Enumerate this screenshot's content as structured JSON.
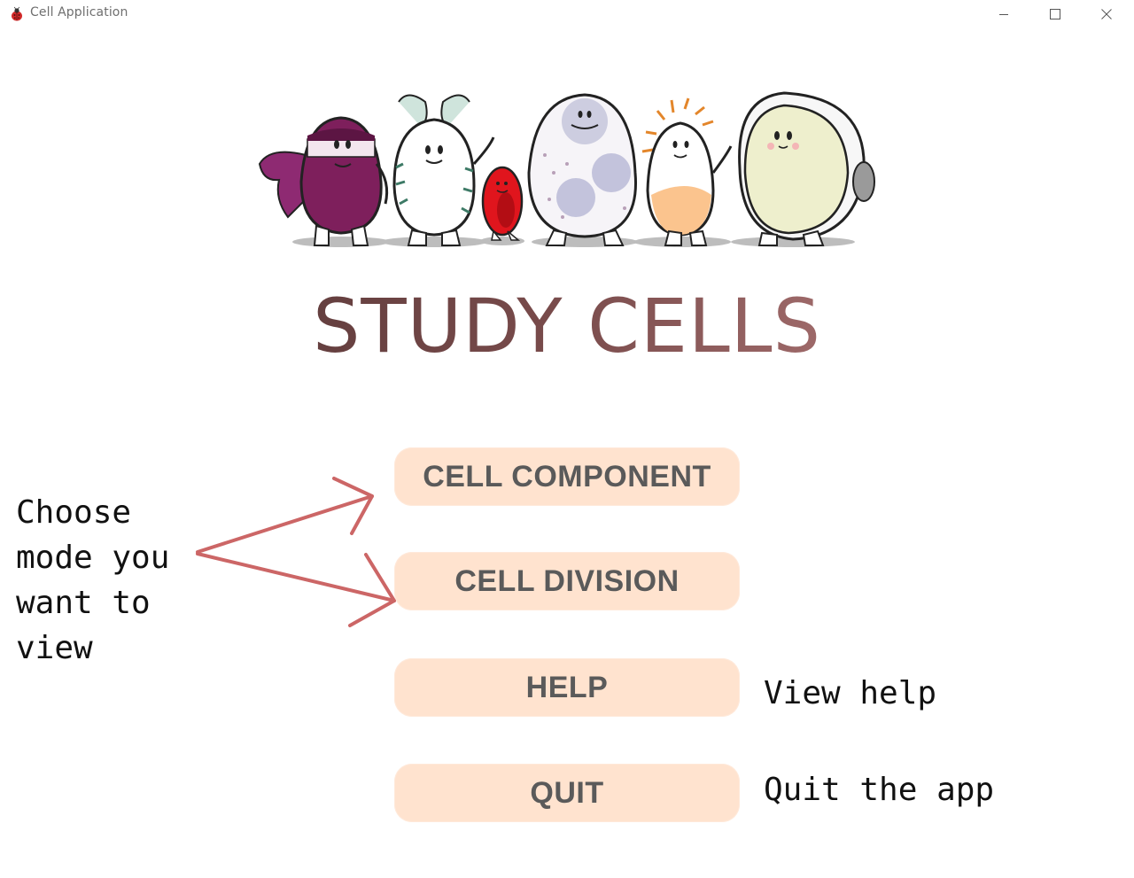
{
  "window": {
    "title": "Cell Application",
    "controls": [
      "minimize",
      "maximize",
      "close"
    ]
  },
  "hero": {
    "description_icon": "cartoon-cells-illustration"
  },
  "main": {
    "title": "STUDY CELLS",
    "buttons": {
      "cell_component": "CELL COMPONENT",
      "cell_division": "CELL DIVISION",
      "help": "HELP",
      "quit": "QUIT"
    },
    "hints": {
      "choose_mode": "Choose\nmode you\nwant to\nview",
      "help": "View help",
      "quit": "Quit the app"
    }
  },
  "colors": {
    "button_bg": "#ffe3cf",
    "button_text": "#5a5a5a",
    "arrow": "#cc6666",
    "title_gradient_start": "#4a2f2f",
    "title_gradient_end": "#c98c8c"
  }
}
